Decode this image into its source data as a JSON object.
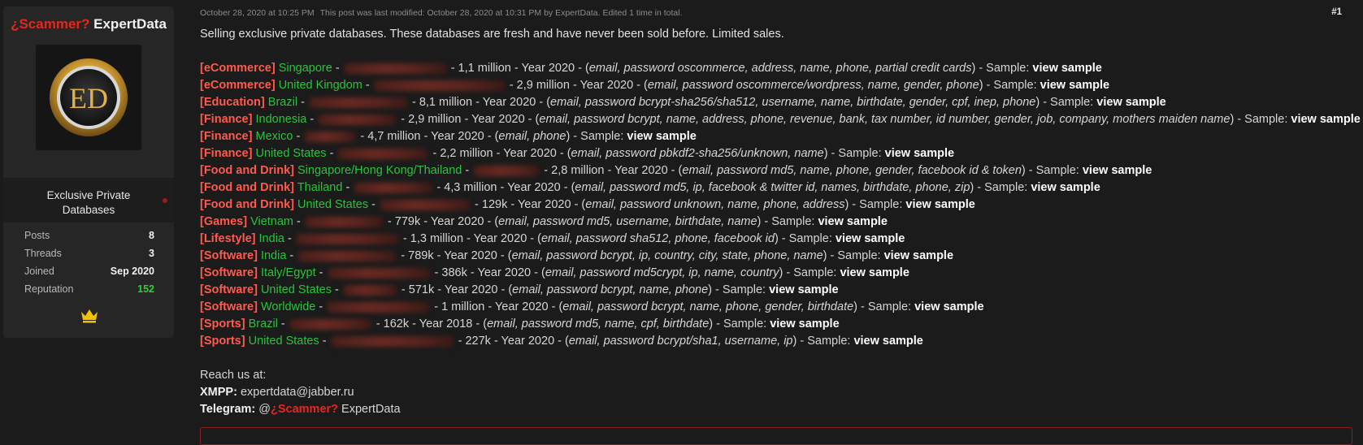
{
  "user": {
    "scammer_tag": "¿Scammer?",
    "name": "ExpertData",
    "avatar_initials": "ED",
    "title": "Exclusive Private Databases",
    "stats": [
      {
        "key": "Posts",
        "value": "8"
      },
      {
        "key": "Threads",
        "value": "3"
      },
      {
        "key": "Joined",
        "value": "Sep 2020"
      },
      {
        "key": "Reputation",
        "value": "152"
      }
    ],
    "badge_icon": "crown-icon"
  },
  "post": {
    "date": "October 28, 2020 at 10:25 PM",
    "modified": "This post was last modified: October 28, 2020 at 10:31 PM by ExpertData. Edited 1 time in total.",
    "number": "#1",
    "intro": "Selling exclusive private databases. These databases are fresh and have never been sold before. Limited sales.",
    "sample_label": "view sample",
    "listings": [
      {
        "category": "[eCommerce]",
        "country": "Singapore",
        "size": "1,1 million",
        "year": "Year 2020",
        "fields": "email, password oscommerce, address, name, phone, partial credit cards"
      },
      {
        "category": "[eCommerce]",
        "country": "United Kingdom",
        "size": "2,9 million",
        "year": "Year 2020",
        "fields": "email, password oscommerce/wordpress, name, gender, phone"
      },
      {
        "category": "[Education]",
        "country": "Brazil",
        "size": "8,1 million",
        "year": "Year 2020",
        "fields": "email, password bcrypt-sha256/sha512, username, name, birthdate, gender, cpf, inep, phone"
      },
      {
        "category": "[Finance]",
        "country": "Indonesia",
        "size": "2,9 million",
        "year": "Year 2020",
        "fields": "email, password bcrypt, name, address, phone, revenue, bank, tax number, id number, gender, job, company, mothers maiden name"
      },
      {
        "category": "[Finance]",
        "country": "Mexico",
        "size": "4,7 million",
        "year": "Year 2020",
        "fields": "email, phone"
      },
      {
        "category": "[Finance]",
        "country": "United States",
        "size": "2,2 million",
        "year": "Year 2020",
        "fields": "email, password pbkdf2-sha256/unknown, name"
      },
      {
        "category": "[Food and Drink]",
        "country": "Singapore/Hong Kong/Thailand",
        "size": "2,8 million",
        "year": "Year 2020",
        "fields": "email, password md5, name, phone, gender, facebook id & token"
      },
      {
        "category": "[Food and Drink]",
        "country": "Thailand",
        "size": "4,3 million",
        "year": "Year 2020",
        "fields": "email, password md5, ip, facebook & twitter id, names, birthdate, phone, zip"
      },
      {
        "category": "[Food and Drink]",
        "country": "United States",
        "size": "129k",
        "year": "Year 2020",
        "fields": "email, password unknown, name, phone, address"
      },
      {
        "category": "[Games]",
        "country": "Vietnam",
        "size": "779k",
        "year": "Year 2020",
        "fields": "email, password md5, username, birthdate, name"
      },
      {
        "category": "[Lifestyle]",
        "country": "India",
        "size": "1,3 million",
        "year": "Year 2020",
        "fields": "email, password sha512, phone, facebook id"
      },
      {
        "category": "[Software]",
        "country": "India",
        "size": "789k",
        "year": "Year 2020",
        "fields": "email, password bcrypt, ip, country, city, state, phone, name"
      },
      {
        "category": "[Software]",
        "country": "Italy/Egypt",
        "size": "386k",
        "year": "Year 2020",
        "fields": "email, password md5crypt, ip, name, country"
      },
      {
        "category": "[Software]",
        "country": "United States",
        "size": "571k",
        "year": "Year 2020",
        "fields": "email, password bcrypt, name, phone"
      },
      {
        "category": "[Software]",
        "country": "Worldwide",
        "size": "1 million",
        "year": "Year 2020",
        "fields": "email, password bcrypt, name, phone, gender, birthdate"
      },
      {
        "category": "[Sports]",
        "country": "Brazil",
        "size": "162k",
        "year": "Year 2018",
        "fields": "email, password md5, name, cpf, birthdate"
      },
      {
        "category": "[Sports]",
        "country": "United States",
        "size": "227k",
        "year": "Year 2020",
        "fields": "email, password bcrypt/sha1, username, ip"
      }
    ],
    "reach": {
      "heading": "Reach us at:",
      "xmpp_label": "XMPP:",
      "xmpp_value": "expertdata@jabber.ru",
      "telegram_label": "Telegram:",
      "telegram_at": "@",
      "telegram_scam": "¿Scammer?",
      "telegram_name": "ExpertData"
    }
  },
  "colors": {
    "category": "#ff5a4d",
    "country": "#29c33b",
    "scam": "#e8251d",
    "reputation": "#2ed12e"
  }
}
